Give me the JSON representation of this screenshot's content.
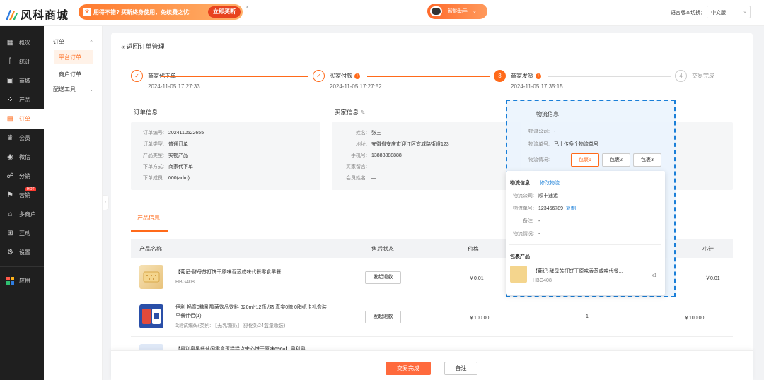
{
  "brand": {
    "name": "风科商城"
  },
  "promo": {
    "text": "用得不错? 买断终身使用，免续费之忧!",
    "button": "立即买断",
    "close": "×"
  },
  "assistant": {
    "label": "智能助手"
  },
  "language": {
    "label": "语言版本切换：",
    "value": "中文版"
  },
  "sidebar": {
    "items": [
      {
        "label": "概况",
        "icon": "dashboard-icon"
      },
      {
        "label": "统计",
        "icon": "chart-icon"
      },
      {
        "label": "商城",
        "icon": "store-icon"
      },
      {
        "label": "产品",
        "icon": "grid-icon"
      },
      {
        "label": "订单",
        "icon": "order-icon",
        "active": true
      },
      {
        "label": "会员",
        "icon": "member-icon"
      },
      {
        "label": "微信",
        "icon": "wechat-icon"
      },
      {
        "label": "分销",
        "icon": "distribution-icon"
      },
      {
        "label": "营销",
        "icon": "marketing-icon",
        "badge": "HOT"
      },
      {
        "label": "多商户",
        "icon": "merchant-icon"
      },
      {
        "label": "互动",
        "icon": "interact-icon"
      },
      {
        "label": "设置",
        "icon": "gear-icon"
      },
      {
        "label": "应用",
        "icon": "apps-icon"
      }
    ]
  },
  "subnav": {
    "group1": "订单",
    "items": [
      "平台订单",
      "商户订单"
    ],
    "group2": "配送工具"
  },
  "page": {
    "back": "返回订单管理"
  },
  "steps": [
    {
      "num": "✓",
      "title": "商家代下单",
      "time": "2024-11-05 17:27:33"
    },
    {
      "num": "✓",
      "title": "买家付款",
      "time": "2024-11-05 17:27:52",
      "warn": "!"
    },
    {
      "num": "3",
      "title": "商家发货",
      "time": "2024-11-05 17:35:15",
      "warn": "!"
    },
    {
      "num": "4",
      "title": "交易完成",
      "time": ""
    }
  ],
  "order_info": {
    "title": "订单信息",
    "rows": [
      {
        "k": "订单编号:",
        "v": "2024110522655"
      },
      {
        "k": "订单类型:",
        "v": "普通订单"
      },
      {
        "k": "产品类型:",
        "v": "实物产品"
      },
      {
        "k": "下单方式:",
        "v": "商家代下单"
      },
      {
        "k": "下单成员:",
        "v": "000(adm)"
      }
    ]
  },
  "buyer_info": {
    "title": "买家信息",
    "rows": [
      {
        "k": "姓名:",
        "v": "张三"
      },
      {
        "k": "地址:",
        "v": "安徽省安庆市迎江区宜城路街道123"
      },
      {
        "k": "手机号:",
        "v": "13888888888"
      },
      {
        "k": "买家留言:",
        "v": "—"
      },
      {
        "k": "会员姓名:",
        "v": "—"
      }
    ]
  },
  "logistics": {
    "title": "物流信息",
    "rows": [
      {
        "k": "物流公司:",
        "v": "-"
      },
      {
        "k": "物流单号:",
        "v": "已上传多个物流单号"
      },
      {
        "k": "物流情况:",
        "v": ""
      }
    ],
    "packages": [
      "包裹1",
      "包裹2",
      "包裹3"
    ]
  },
  "popover": {
    "title": "物流信息",
    "edit": "修改物流",
    "rows": [
      {
        "k": "物流公司:",
        "v": "顺丰速运"
      },
      {
        "k": "物流单号:",
        "v": "123456789"
      },
      {
        "k": "备注:",
        "v": "-"
      },
      {
        "k": "物流情况:",
        "v": "-"
      }
    ],
    "copy": "复制",
    "pkg_title": "包裹产品",
    "pkg_name": "【葡记-酵母苏打饼干原味香葱咸味代餐...",
    "pkg_sku": "HBG408",
    "pkg_qty": "x1"
  },
  "tabs": {
    "product": "产品信息"
  },
  "table": {
    "headers": [
      "产品名称",
      "售后状态",
      "价格",
      "小计"
    ],
    "rows": [
      {
        "name": "【葡记-酵母苏打饼干原味香葱咸味代餐零食早餐",
        "sku": "HBG408",
        "action": "发起退款",
        "price": "￥0.01",
        "qty": "",
        "subtotal": "￥0.01"
      },
      {
        "name": "伊利 畅意0糖乳酸菌饮品饮料 320ml*12瓶 /箱 真实0糖 0脂纸卡礼盒装 早餐伴侣(1)",
        "sku": "1测试编码(类别: 【无乳糖奶】 舒化奶24盒量贩装)",
        "action": "发起退款",
        "price": "￥100.00",
        "qty": "1",
        "subtotal": "￥100.00"
      },
      {
        "name": "【奥利奥早餐休闲零食蛋糕糕点夹心饼干原味696g】奥利奥",
        "sku": "",
        "action": "",
        "price": "",
        "qty": "",
        "subtotal": ""
      }
    ]
  },
  "footer": {
    "complete": "交易完成",
    "note": "备注"
  },
  "colors": {
    "accent": "#ff6a1a",
    "link": "#1a7fd8",
    "sidebar": "#1f1f1f"
  }
}
